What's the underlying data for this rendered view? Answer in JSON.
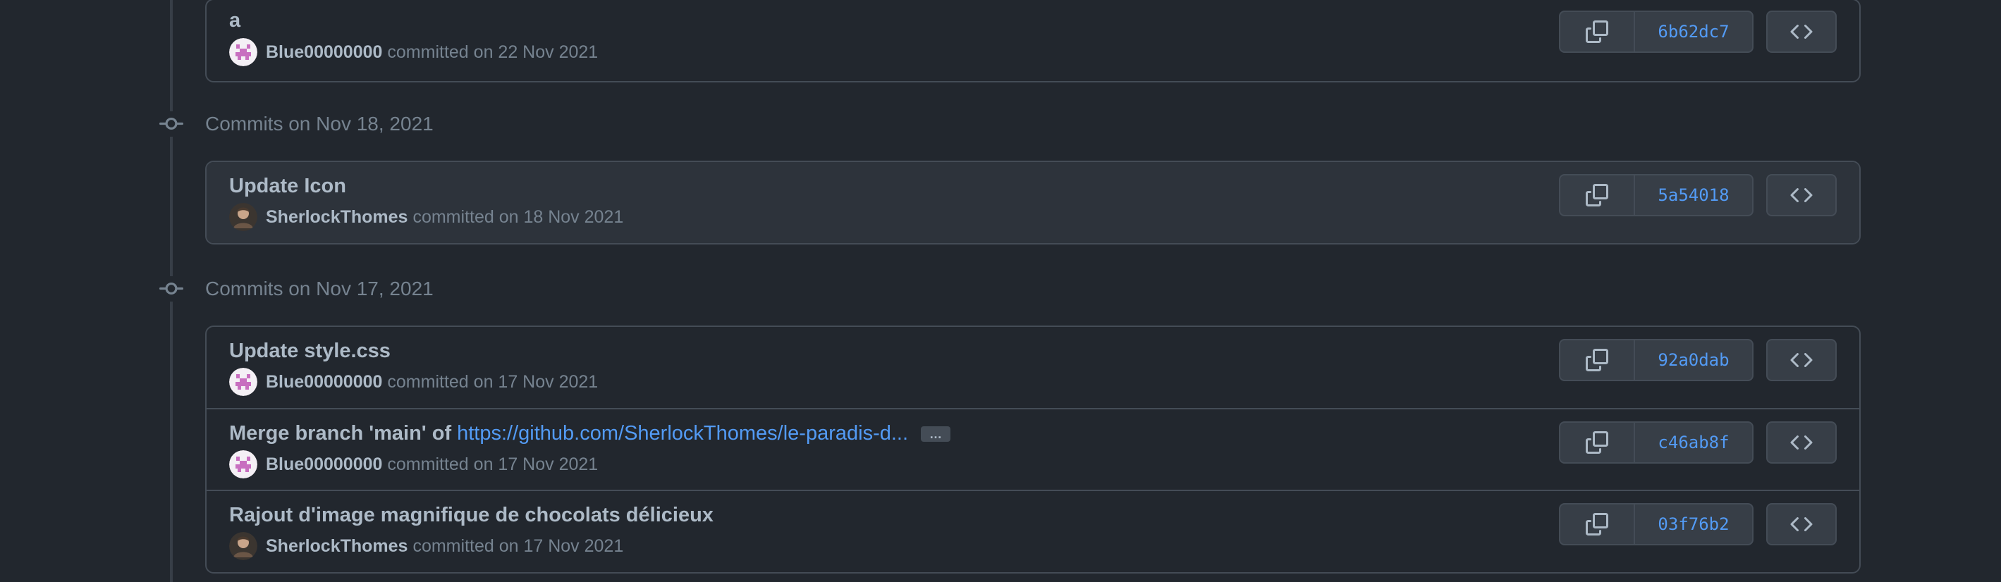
{
  "colors": {
    "background": "#22272e",
    "border": "#444c56",
    "text_primary": "#adbac7",
    "text_muted": "#768390",
    "link": "#539bf5",
    "button_bg": "#373e47"
  },
  "groups": [
    {
      "header": "",
      "commits": [
        {
          "title": "a",
          "author": "Blue00000000",
          "avatar": "identicon-pink",
          "committed": "committed on 22 Nov 2021",
          "sha": "6b62dc7"
        }
      ]
    },
    {
      "header": "Commits on Nov 18, 2021",
      "commits": [
        {
          "title": "Update Icon",
          "author": "SherlockThomes",
          "avatar": "photo-avatar",
          "committed": "committed on 18 Nov 2021",
          "sha": "5a54018"
        }
      ]
    },
    {
      "header": "Commits on Nov 17, 2021",
      "commits": [
        {
          "title": "Update style.css",
          "author": "Blue00000000",
          "avatar": "identicon-pink",
          "committed": "committed on 17 Nov 2021",
          "sha": "92a0dab"
        },
        {
          "title": "Merge branch 'main' of",
          "title_link": "https://github.com/SherlockThomes/le-paradis-d...",
          "ellipsis": "…",
          "author": "Blue00000000",
          "avatar": "identicon-pink",
          "committed": "committed on 17 Nov 2021",
          "sha": "c46ab8f"
        },
        {
          "title": "Rajout d'image magnifique de chocolats délicieux",
          "author": "SherlockThomes",
          "avatar": "photo-avatar",
          "committed": "committed on 17 Nov 2021",
          "sha": "03f76b2"
        }
      ]
    }
  ],
  "icons": {
    "commit_node": "git-commit-icon",
    "copy": "copy-icon",
    "browse": "code-icon"
  }
}
